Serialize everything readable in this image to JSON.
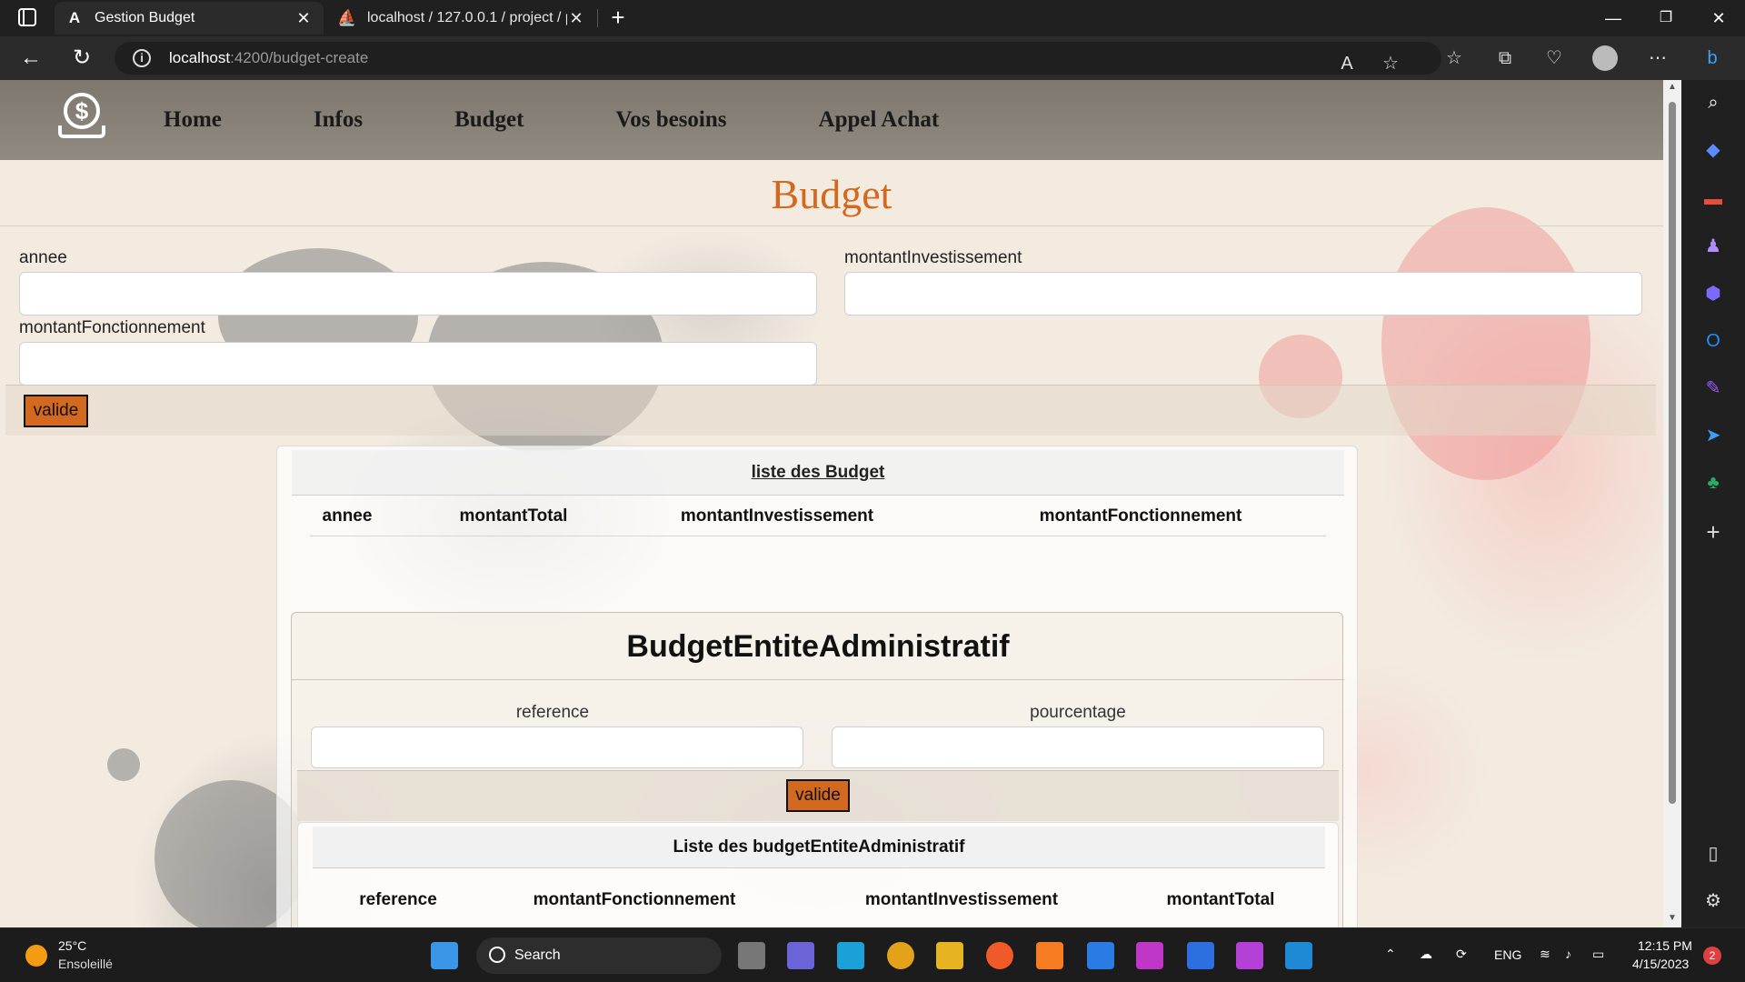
{
  "browser": {
    "tabs": [
      {
        "title": "Gestion Budget",
        "icon": "angular-icon"
      },
      {
        "title": "localhost / 127.0.0.1 / project / p",
        "icon": "phpmyadmin-icon"
      }
    ],
    "url_host": "localhost",
    "url_path": ":4200/budget-create"
  },
  "app": {
    "nav": [
      "Home",
      "Infos",
      "Budget",
      "Vos besoins",
      "Appel Achat"
    ],
    "page_title": "Budget",
    "form": {
      "annee_label": "annee",
      "annee_value": "",
      "montantInvestissement_label": "montantInvestissement",
      "montantInvestissement_value": "",
      "montantFonctionnement_label": "montantFonctionnement",
      "montantFonctionnement_value": "",
      "submit_label": "valide"
    },
    "budget_list": {
      "title": "liste des Budget",
      "columns": [
        "annee",
        "montantTotal",
        "montantInvestissement",
        "montantFonctionnement"
      ],
      "rows": []
    },
    "budget_entite": {
      "title": "BudgetEntiteAdministratif",
      "reference_label": "reference",
      "reference_value": "",
      "pourcentage_label": "pourcentage",
      "pourcentage_value": "",
      "submit_label": "valide",
      "list_title": "Liste des budgetEntiteAdministratif",
      "columns": [
        "reference",
        "montantFonctionnement",
        "montantInvestissement",
        "montantTotal"
      ]
    }
  },
  "taskbar": {
    "weather_temp": "25°C",
    "weather_desc": "Ensoleillé",
    "search_label": "Search",
    "lang": "ENG",
    "time": "12:15 PM",
    "date": "4/15/2023",
    "notifications": "2"
  },
  "colors": {
    "accent": "#d2691e",
    "header_bg": "#8a8378",
    "page_bg": "#f3ebe0"
  }
}
